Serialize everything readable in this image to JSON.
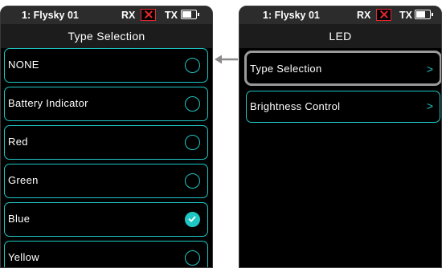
{
  "colors": {
    "accent": "#1ec6c4",
    "background": "#000000",
    "status_bg": "#2c2c2c",
    "title_bg": "#1c1c1c",
    "rx_error": "#e8262e",
    "highlight": "#9a9a9a"
  },
  "left_screen": {
    "status": {
      "model": "1: Flysky 01",
      "rx": "RX",
      "tx": "TX",
      "rx_icon": "close-icon",
      "battery_icon": "battery-icon"
    },
    "title": "Type Selection",
    "options": [
      {
        "label": "NONE",
        "selected": false
      },
      {
        "label": "Battery Indicator",
        "selected": false
      },
      {
        "label": "Red",
        "selected": false
      },
      {
        "label": "Green",
        "selected": false
      },
      {
        "label": "Blue",
        "selected": true
      },
      {
        "label": "Yellow",
        "selected": false
      }
    ]
  },
  "right_screen": {
    "status": {
      "model": "1: Flysky 01",
      "rx": "RX",
      "tx": "TX",
      "rx_icon": "close-icon",
      "battery_icon": "battery-icon"
    },
    "title": "LED",
    "menu": [
      {
        "label": "Type Selection",
        "chevron": ">",
        "highlighted": true
      },
      {
        "label": "Brightness Control",
        "chevron": ">",
        "highlighted": false
      }
    ]
  },
  "connector_icon": "arrow-left-icon"
}
